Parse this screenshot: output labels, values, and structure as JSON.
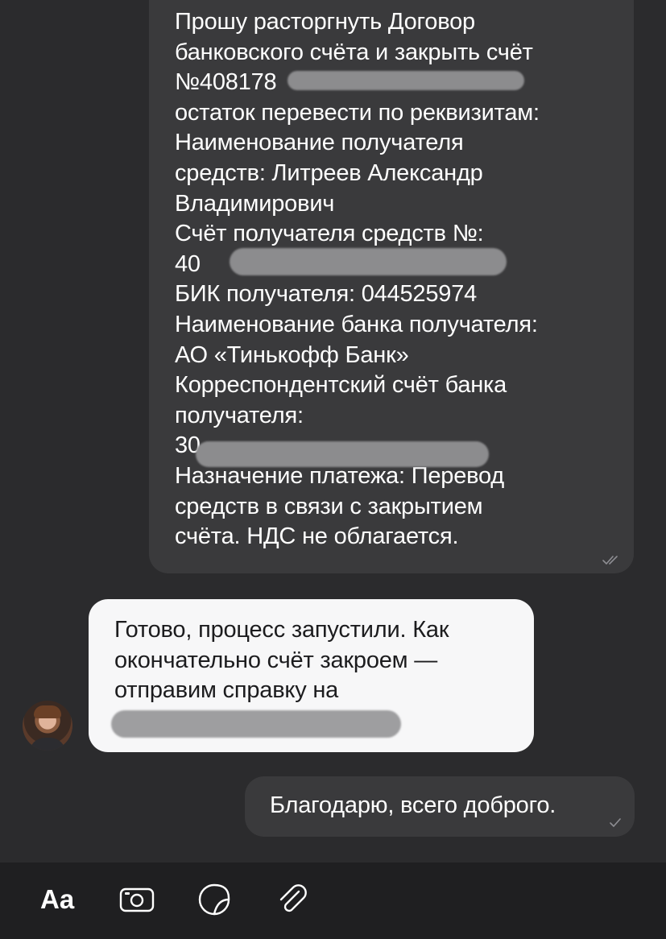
{
  "messages": {
    "outgoing_request": {
      "lines": [
        "Прошу расторгнуть Договор",
        "банковского счёта и закрыть счёт",
        "№408178",
        "остаток перевести по реквизитам:",
        "Наименование получателя",
        "средств: Литреев Александр",
        "Владимирович",
        "Счёт получателя средств №:",
        "40",
        "БИК получателя: 044525974",
        "Наименование банка получателя:",
        "АО «Тинькофф Банк»",
        "Корреспондентский счёт банка",
        "получателя:",
        "30",
        "Назначение платежа: Перевод",
        "средств в связи с закрытием",
        "счёта. НДС не облагается."
      ],
      "status_icon": "double-check-icon"
    },
    "incoming_reply": {
      "lines": [
        "Готово, процесс запустили. Как",
        "окончательно счёт закроем —",
        "отправим справку на"
      ],
      "avatar_icon": "user-avatar"
    },
    "outgoing_thanks": {
      "text": "Благодарю, всего доброго.",
      "status_icon": "single-check-icon"
    }
  },
  "toolbar": {
    "text_format_label": "Aa",
    "camera_icon": "camera-icon",
    "sticker_icon": "sticker-icon",
    "attach_icon": "paperclip-icon"
  }
}
